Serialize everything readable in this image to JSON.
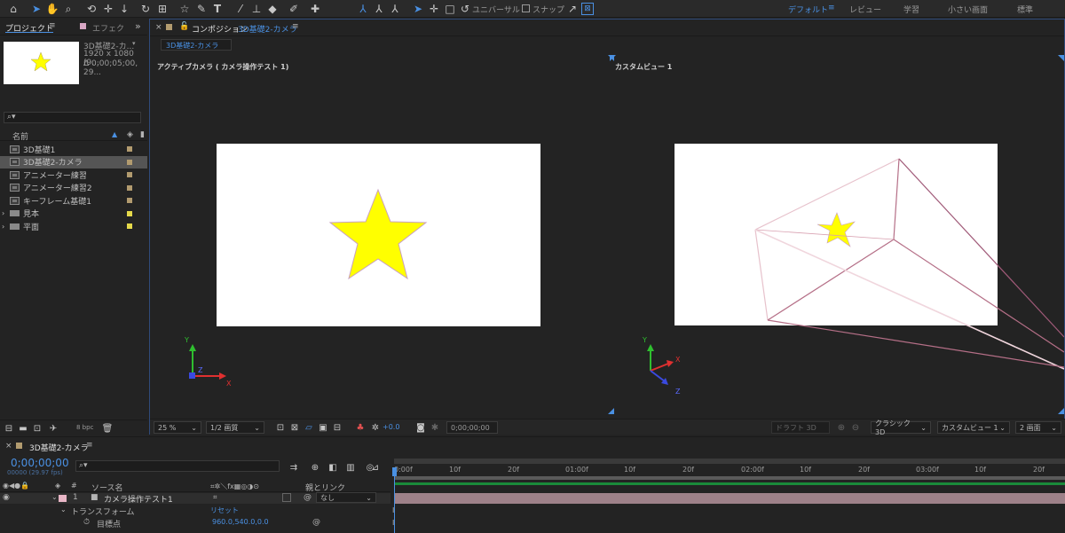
{
  "toolbar": {
    "tools": [
      "home-icon",
      "selection-arrow-icon",
      "hand-icon",
      "zoom-icon",
      "orbit-camera-icon",
      "pan-camera-icon",
      "dolly-camera-icon",
      "rotate-icon",
      "anchor-icon",
      "shape-star-icon",
      "pen-icon",
      "type-icon",
      "brush-icon",
      "clone-stamp-icon",
      "eraser-icon",
      "roto-brush-icon",
      "puppet-pin-icon"
    ],
    "axis_label": "ユニバーサル",
    "snap_label": "スナップ",
    "workspaces": [
      "デフォルト",
      "レビュー",
      "学習",
      "小さい画面",
      "標準"
    ]
  },
  "project": {
    "tab_label": "プロジェクト",
    "effects_tab_label": "エフェク",
    "thumb_name": "3D基礎2-カ...",
    "thumb_size": "1920 x 1080 (9...",
    "thumb_duration": "Δ 0;00;05;00, 29...",
    "search_placeholder": "",
    "column_name": "名前",
    "bpc": "8 bpc",
    "items": [
      {
        "name": "3D基礎1",
        "type": "comp",
        "color": "#b29b6f"
      },
      {
        "name": "3D基礎2-カメラ",
        "type": "comp",
        "color": "#b29b6f",
        "selected": true
      },
      {
        "name": "アニメーター練習",
        "type": "comp",
        "color": "#b29b6f"
      },
      {
        "name": "アニメーター練習2",
        "type": "comp",
        "color": "#b29b6f"
      },
      {
        "name": "キーフレーム基礎1",
        "type": "comp",
        "color": "#b29b6f"
      },
      {
        "name": "見本",
        "type": "folder",
        "color": "#e5d94a"
      },
      {
        "name": "平面",
        "type": "folder",
        "color": "#e5d94a"
      }
    ]
  },
  "composition": {
    "panel_label": "コンポジション",
    "comp_name": "3D基礎2-カメラ",
    "subtab": "3D基礎2-カメラ",
    "left_view_label": "アクティブカメラ ( カメラ操作テスト 1)",
    "right_view_label": "カスタムビュー 1",
    "zoom": "25 %",
    "resolution": "1/2 画質",
    "exposure": "+0.0",
    "timecode": "0;00;00;00",
    "draft3d": "ドラフト 3D",
    "renderer": "クラシック 3D",
    "view_select": "カスタムビュー 1",
    "view_layout": "2 画面",
    "star_color": "#ffff00",
    "axis": {
      "y": "Y",
      "x": "X",
      "z": "Z"
    }
  },
  "timeline": {
    "tab_label": "3D基礎2-カメラ",
    "timecode": "0;00;00;00",
    "frame_info": "00000 (29.97 fps)",
    "col_source": "ソース名",
    "col_parent": "親とリンク",
    "layer_number": "1",
    "layer_name": "カメラ操作テスト1",
    "parent_value": "なし",
    "transform_label": "トランスフォーム",
    "reset_label": "リセット",
    "prop_name": "目標点",
    "prop_value": "960.0,540.0,0.0",
    "ruler": [
      "0:00f",
      "10f",
      "20f",
      "01:00f",
      "10f",
      "20f",
      "02:00f",
      "10f",
      "20f",
      "03:00f",
      "10f",
      "20f"
    ]
  }
}
